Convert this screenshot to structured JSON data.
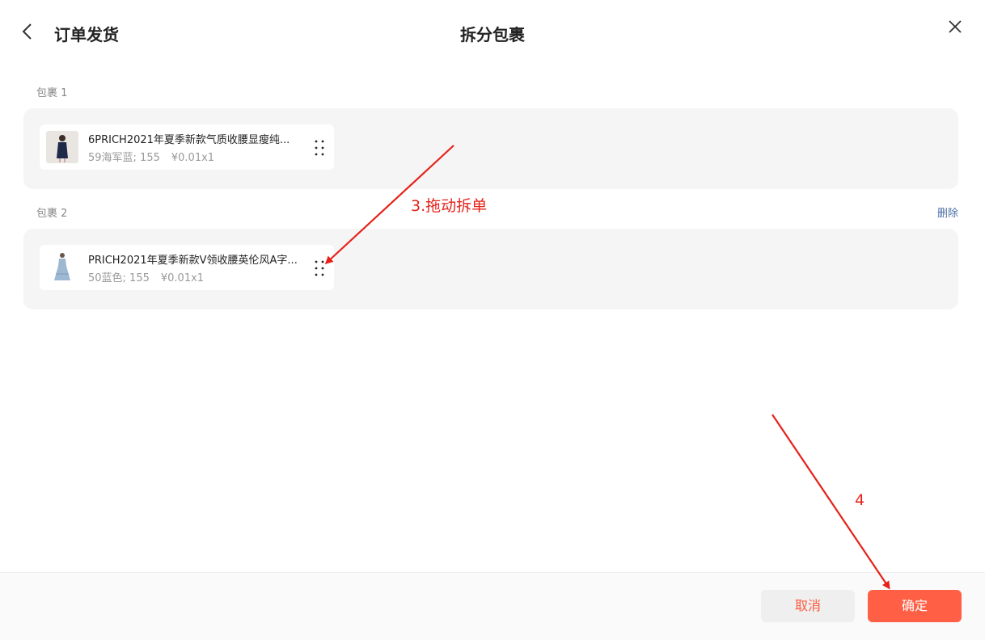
{
  "header": {
    "back_title": "订单发货",
    "title": "拆分包裹"
  },
  "packages": [
    {
      "label": "包裹 1",
      "items": [
        {
          "title": "6PRICH2021年夏季新款气质收腰显瘦纯...",
          "spec": "59海军蓝; 155",
          "price": "¥0.01x1"
        }
      ]
    },
    {
      "label": "包裹 2",
      "delete_label": "删除",
      "items": [
        {
          "title": "PRICH2021年夏季新款V领收腰英伦风A字...",
          "spec": "50蓝色; 155",
          "price": "¥0.01x1"
        }
      ]
    }
  ],
  "footer": {
    "cancel_label": "取消",
    "confirm_label": "确定"
  },
  "annotations": {
    "drag_hint": "3.拖动拆单",
    "step4": "4"
  },
  "colors": {
    "accent": "#ff5f45",
    "annotation_red": "#e5221a"
  }
}
